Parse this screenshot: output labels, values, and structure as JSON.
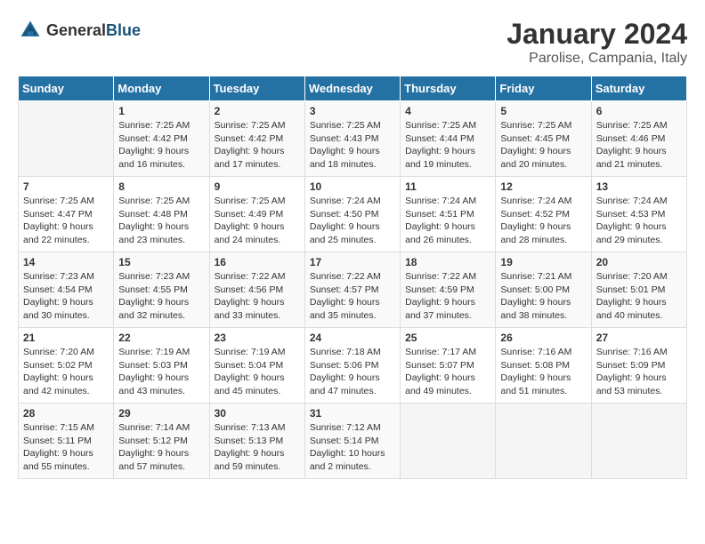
{
  "logo": {
    "general": "General",
    "blue": "Blue"
  },
  "title": {
    "month_year": "January 2024",
    "location": "Parolise, Campania, Italy"
  },
  "headers": [
    "Sunday",
    "Monday",
    "Tuesday",
    "Wednesday",
    "Thursday",
    "Friday",
    "Saturday"
  ],
  "weeks": [
    [
      {
        "day": "",
        "info": ""
      },
      {
        "day": "1",
        "info": "Sunrise: 7:25 AM\nSunset: 4:42 PM\nDaylight: 9 hours\nand 16 minutes."
      },
      {
        "day": "2",
        "info": "Sunrise: 7:25 AM\nSunset: 4:42 PM\nDaylight: 9 hours\nand 17 minutes."
      },
      {
        "day": "3",
        "info": "Sunrise: 7:25 AM\nSunset: 4:43 PM\nDaylight: 9 hours\nand 18 minutes."
      },
      {
        "day": "4",
        "info": "Sunrise: 7:25 AM\nSunset: 4:44 PM\nDaylight: 9 hours\nand 19 minutes."
      },
      {
        "day": "5",
        "info": "Sunrise: 7:25 AM\nSunset: 4:45 PM\nDaylight: 9 hours\nand 20 minutes."
      },
      {
        "day": "6",
        "info": "Sunrise: 7:25 AM\nSunset: 4:46 PM\nDaylight: 9 hours\nand 21 minutes."
      }
    ],
    [
      {
        "day": "7",
        "info": "Sunrise: 7:25 AM\nSunset: 4:47 PM\nDaylight: 9 hours\nand 22 minutes."
      },
      {
        "day": "8",
        "info": "Sunrise: 7:25 AM\nSunset: 4:48 PM\nDaylight: 9 hours\nand 23 minutes."
      },
      {
        "day": "9",
        "info": "Sunrise: 7:25 AM\nSunset: 4:49 PM\nDaylight: 9 hours\nand 24 minutes."
      },
      {
        "day": "10",
        "info": "Sunrise: 7:24 AM\nSunset: 4:50 PM\nDaylight: 9 hours\nand 25 minutes."
      },
      {
        "day": "11",
        "info": "Sunrise: 7:24 AM\nSunset: 4:51 PM\nDaylight: 9 hours\nand 26 minutes."
      },
      {
        "day": "12",
        "info": "Sunrise: 7:24 AM\nSunset: 4:52 PM\nDaylight: 9 hours\nand 28 minutes."
      },
      {
        "day": "13",
        "info": "Sunrise: 7:24 AM\nSunset: 4:53 PM\nDaylight: 9 hours\nand 29 minutes."
      }
    ],
    [
      {
        "day": "14",
        "info": "Sunrise: 7:23 AM\nSunset: 4:54 PM\nDaylight: 9 hours\nand 30 minutes."
      },
      {
        "day": "15",
        "info": "Sunrise: 7:23 AM\nSunset: 4:55 PM\nDaylight: 9 hours\nand 32 minutes."
      },
      {
        "day": "16",
        "info": "Sunrise: 7:22 AM\nSunset: 4:56 PM\nDaylight: 9 hours\nand 33 minutes."
      },
      {
        "day": "17",
        "info": "Sunrise: 7:22 AM\nSunset: 4:57 PM\nDaylight: 9 hours\nand 35 minutes."
      },
      {
        "day": "18",
        "info": "Sunrise: 7:22 AM\nSunset: 4:59 PM\nDaylight: 9 hours\nand 37 minutes."
      },
      {
        "day": "19",
        "info": "Sunrise: 7:21 AM\nSunset: 5:00 PM\nDaylight: 9 hours\nand 38 minutes."
      },
      {
        "day": "20",
        "info": "Sunrise: 7:20 AM\nSunset: 5:01 PM\nDaylight: 9 hours\nand 40 minutes."
      }
    ],
    [
      {
        "day": "21",
        "info": "Sunrise: 7:20 AM\nSunset: 5:02 PM\nDaylight: 9 hours\nand 42 minutes."
      },
      {
        "day": "22",
        "info": "Sunrise: 7:19 AM\nSunset: 5:03 PM\nDaylight: 9 hours\nand 43 minutes."
      },
      {
        "day": "23",
        "info": "Sunrise: 7:19 AM\nSunset: 5:04 PM\nDaylight: 9 hours\nand 45 minutes."
      },
      {
        "day": "24",
        "info": "Sunrise: 7:18 AM\nSunset: 5:06 PM\nDaylight: 9 hours\nand 47 minutes."
      },
      {
        "day": "25",
        "info": "Sunrise: 7:17 AM\nSunset: 5:07 PM\nDaylight: 9 hours\nand 49 minutes."
      },
      {
        "day": "26",
        "info": "Sunrise: 7:16 AM\nSunset: 5:08 PM\nDaylight: 9 hours\nand 51 minutes."
      },
      {
        "day": "27",
        "info": "Sunrise: 7:16 AM\nSunset: 5:09 PM\nDaylight: 9 hours\nand 53 minutes."
      }
    ],
    [
      {
        "day": "28",
        "info": "Sunrise: 7:15 AM\nSunset: 5:11 PM\nDaylight: 9 hours\nand 55 minutes."
      },
      {
        "day": "29",
        "info": "Sunrise: 7:14 AM\nSunset: 5:12 PM\nDaylight: 9 hours\nand 57 minutes."
      },
      {
        "day": "30",
        "info": "Sunrise: 7:13 AM\nSunset: 5:13 PM\nDaylight: 9 hours\nand 59 minutes."
      },
      {
        "day": "31",
        "info": "Sunrise: 7:12 AM\nSunset: 5:14 PM\nDaylight: 10 hours\nand 2 minutes."
      },
      {
        "day": "",
        "info": ""
      },
      {
        "day": "",
        "info": ""
      },
      {
        "day": "",
        "info": ""
      }
    ]
  ]
}
